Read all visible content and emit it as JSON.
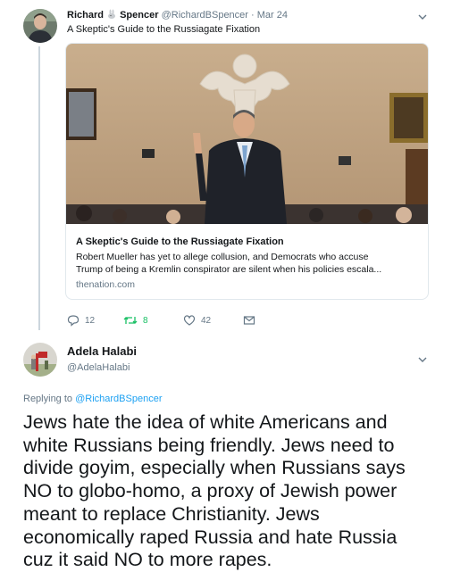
{
  "tweet1": {
    "name_first": "Richard",
    "name_last": "Spencer",
    "name_emoji_icon": "rabbit-emoji",
    "handle": "@RichardBSpencer",
    "separator": "·",
    "date": "Mar 24",
    "text": "A Skeptic's Guide to the Russiagate Fixation",
    "card": {
      "title": "A Skeptic's Guide to the Russiagate Fixation",
      "description_line1": "Robert Mueller has yet to allege collusion, and Democrats who accuse",
      "description_line2": "Trump of being a Kremlin conspirator are silent when his policies escala...",
      "domain": "thenation.com"
    },
    "actions": {
      "replies": "12",
      "retweets": "8",
      "likes": "42"
    }
  },
  "tweet2": {
    "name": "Adela Halabi",
    "handle": "@AdelaHalabi",
    "replying_label": "Replying to",
    "replying_to": "@RichardBSpencer",
    "text_lines": [
      "Jews hate the idea of white Americans and",
      "white Russians being friendly. Jews need to",
      "divide goyim, especially when Russians says",
      "NO to globo-homo, a proxy of Jewish power",
      "meant to replace Christianity. Jews",
      "economically raped Russia and hate Russia",
      "cuz it said NO to more rapes."
    ]
  },
  "colors": {
    "text": "#14171a",
    "muted": "#657786",
    "link": "#1da1f2",
    "retweet_green": "#17bf63",
    "border": "#e1e8ed",
    "thread_line": "#ccd6dd"
  }
}
